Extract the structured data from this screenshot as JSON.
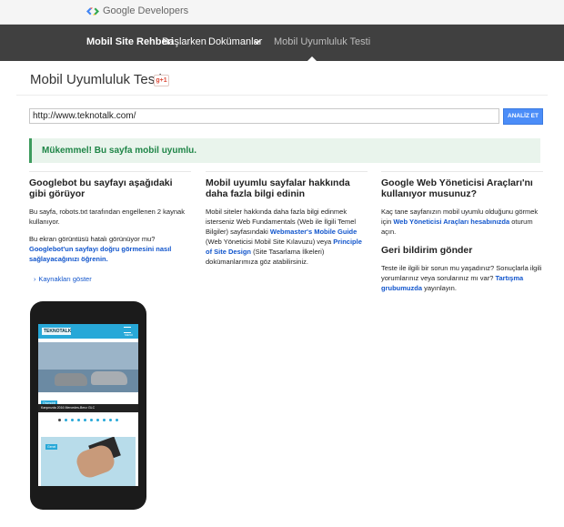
{
  "header": {
    "logo_text": "Google Developers"
  },
  "nav": {
    "brand": "Mobil Site Rehberi",
    "items": [
      "Başlarken",
      "Dokümanlar",
      "Mobil Uyumluluk Testi"
    ]
  },
  "page": {
    "title": "Mobil Uyumluluk Testi",
    "gplus_label": "g+1"
  },
  "form": {
    "url_value": "http://www.teknotalk.com/",
    "analyze_label": "ANALİZ ET"
  },
  "result": {
    "message": "Mükemmel! Bu sayfa mobil uyumlu."
  },
  "col1": {
    "heading": "Googlebot bu sayfayı aşağıdaki gibi görüyor",
    "p1": "Bu sayfa, robots.txt tarafından engellenen 2 kaynak kullanıyor.",
    "p2_text": "Bu ekran görüntüsü hatalı görünüyor mu?",
    "p2_link": "Googlebot'un sayfayı doğru görmesini nasıl sağlayacağınızı öğrenin.",
    "resources_link": "Kaynakları göster"
  },
  "col2": {
    "heading": "Mobil uyumlu sayfalar hakkında daha fazla bilgi edinin",
    "p_text1": "Mobil siteler hakkında daha fazla bilgi edinmek isterseniz Web Fundamentals (Web ile İlgili Temel Bilgiler) sayfasındaki ",
    "link1": "Webmaster's Mobile Guide",
    "p_text2": " (Web Yöneticisi Mobil Site Kılavuzu) veya ",
    "link2": "Principle of Site Design",
    "p_text3": " (Site Tasarlama İlkeleri) dokümanlarımıza göz atabilirsiniz."
  },
  "col3": {
    "heading1": "Google Web Yöneticisi Araçları'nı kullanıyor musunuz?",
    "p1_text1": "Kaç tane sayfanızın mobil uyumlu olduğunu görmek için ",
    "p1_link": "Web Yöneticisi Araçları hesabınızda",
    "p1_text2": " oturum açın.",
    "heading2": "Geri bildirim gönder",
    "p2_text1": "Teste ile ilgili bir sorun mu yaşadınız? Sonuçlarla ilgili yorumlarınız veya sorularınız mı var? ",
    "p2_link": "Tartışma grubumuzda",
    "p2_text2": " yayınlayın."
  },
  "preview": {
    "site_logo": "TEKNOTALK",
    "menu_label": "MENÜ",
    "slide_badge": "Otomobil",
    "slide_caption": "Karşınızda 2016 Mercedes-Benz GLC",
    "second_badge": "Genel",
    "dot_count_label": "",
    "accent_color": "#27a8d8"
  },
  "colors": {
    "nav_bg": "#404040",
    "success_bg": "#e9f4ec",
    "success_text": "#1f8547",
    "button_blue": "#4b8df8",
    "link": "#1155cc"
  }
}
